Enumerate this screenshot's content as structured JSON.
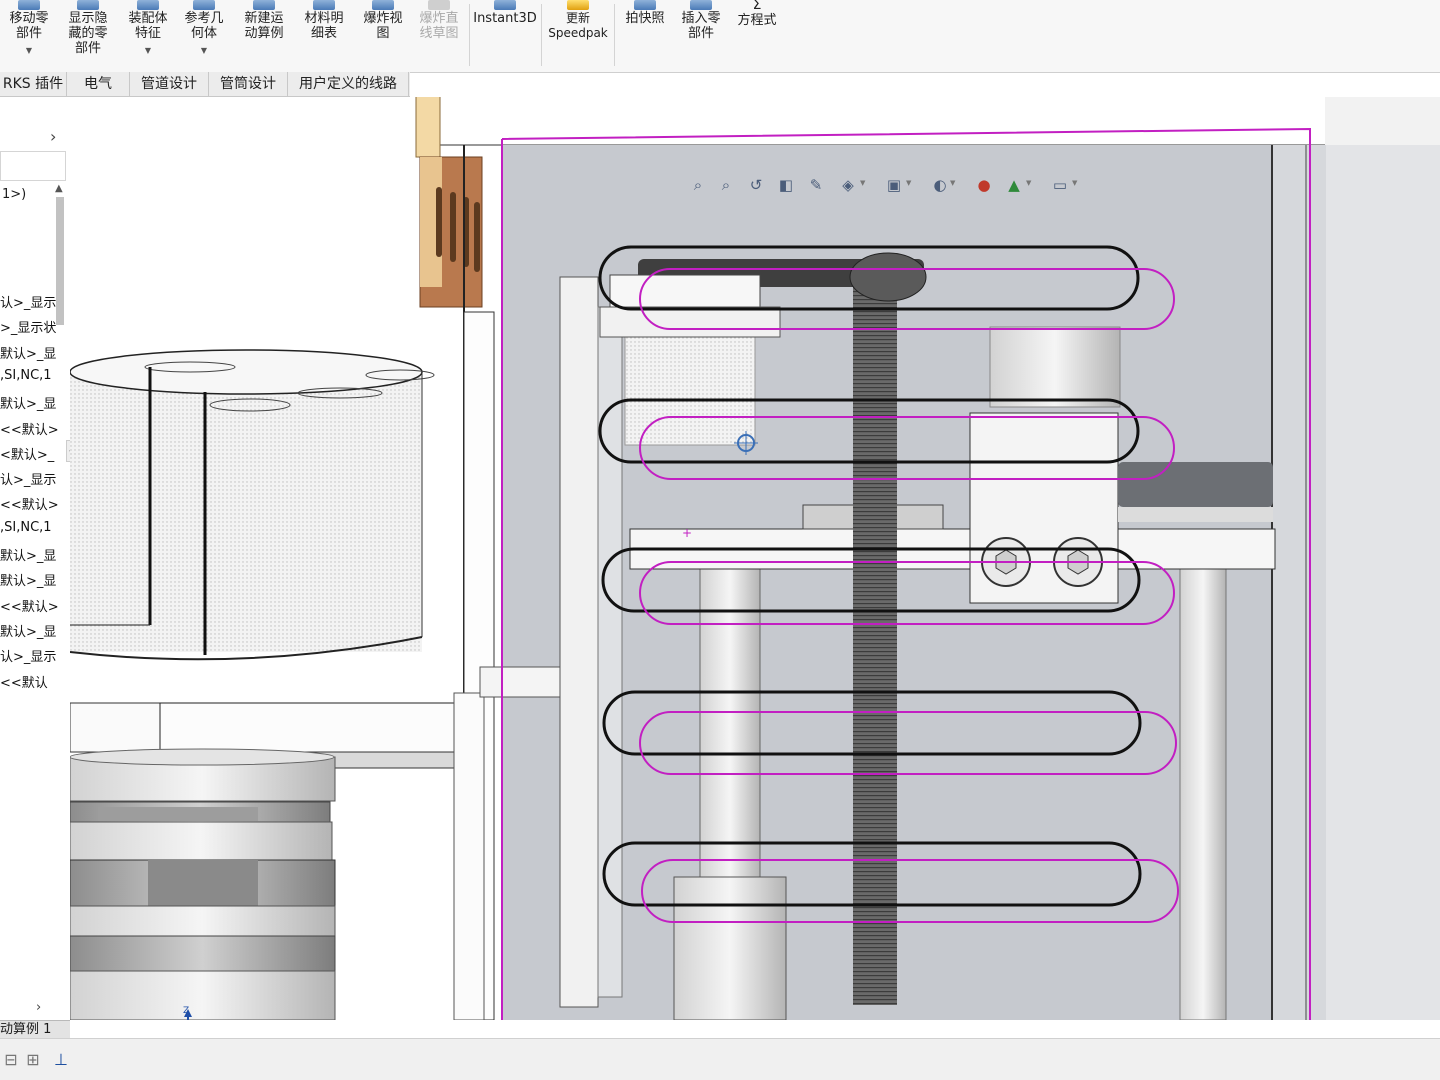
{
  "ribbon": {
    "buttons": [
      {
        "label": "移动零\n部件",
        "dropdown": true
      },
      {
        "label": "显示隐\n藏的零\n部件",
        "dropdown": false
      },
      {
        "label": "装配体\n特征",
        "dropdown": true
      },
      {
        "label": "参考几\n何体",
        "dropdown": true
      },
      {
        "label": "新建运\n动算例",
        "dropdown": false
      },
      {
        "label": "材料明\n细表",
        "dropdown": false
      },
      {
        "label": "爆炸视\n图",
        "dropdown": false
      },
      {
        "label": "爆炸直\n线草图",
        "dropdown": false,
        "disabled": true
      },
      {
        "label": "Instant3D",
        "dropdown": false
      },
      {
        "label": "更新\nSpeedpak",
        "dropdown": false
      },
      {
        "label": "拍快照",
        "dropdown": false
      },
      {
        "label": "插入零\n部件",
        "dropdown": false
      },
      {
        "label": "方程式",
        "dropdown": false
      }
    ]
  },
  "tabs": [
    "RKS 插件",
    "电气",
    "管道设计",
    "管筒设计",
    "用户定义的线路"
  ],
  "tree": {
    "root_label": "1>)",
    "items": [
      "认>_显示",
      ">_显示状",
      "默认>_显",
      ",SI,NC,1",
      "默认>_显",
      "<<默认>",
      "<默认>_",
      "认>_显示",
      "<<默认>",
      ",SI,NC,1",
      "默认>_显",
      "默认>_显",
      "<<默认>",
      "默认>_显",
      "认>_显示",
      "<<默认"
    ]
  },
  "bottom": {
    "active_tab": "动算例 1"
  },
  "triad": {
    "z_label": "Z",
    "x_label": "X"
  },
  "hud_icons": [
    "zoom-to-fit-icon",
    "zoom-area-icon",
    "previous-view-icon",
    "section-view-icon",
    "dynamic-annotation-icon",
    "view-orientation-icon",
    "display-style-icon",
    "hide-show-icon",
    "edit-appearance-icon",
    "apply-scene-icon",
    "view-settings-icon"
  ],
  "colors": {
    "magenta_outline": "#c21fc2",
    "frame_gray": "#c6c9cf",
    "copper": "#b9794e",
    "leadscrew": "#5c5c5c"
  }
}
